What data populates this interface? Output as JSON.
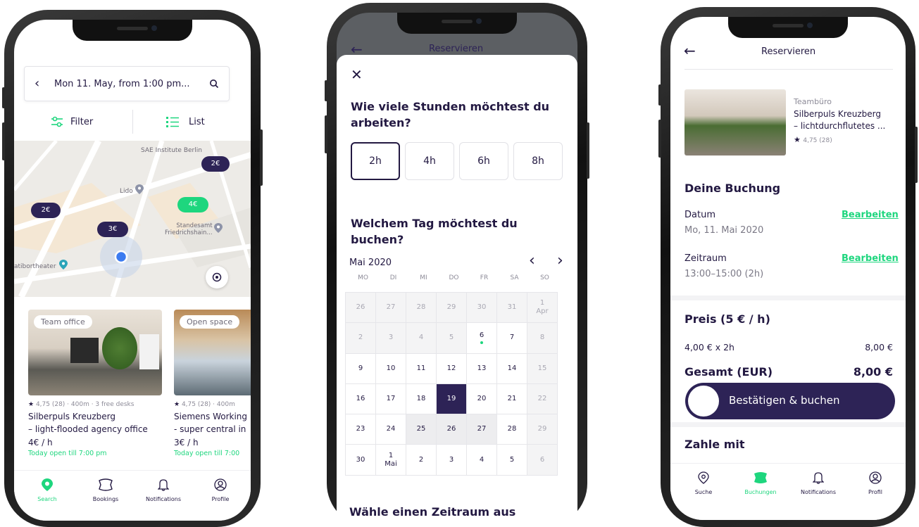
{
  "phone1": {
    "search": {
      "text": "Mon 11. May, from 1:00 pm..."
    },
    "filter_label": "Filter",
    "list_label": "List",
    "map": {
      "labels": {
        "sae": "SAE Institute Berlin",
        "lido": "Lido",
        "standesamt": "Standesamt\nFriedrichshain...",
        "theater": "atibortheater"
      },
      "pins": [
        {
          "label": "2€",
          "color": "#2d2356"
        },
        {
          "label": "4€",
          "color": "#1ed67e"
        },
        {
          "label": "2€",
          "color": "#2d2356"
        },
        {
          "label": "3€",
          "color": "#2d2356"
        }
      ]
    },
    "cards": [
      {
        "badge": "Team office",
        "meta": "4,75 (28) · 400m · 3 free desks",
        "title1": "Silberpuls Kreuzberg",
        "title2": "– light-flooded agency office",
        "price": "4€ / h",
        "open": "Today open till 7:00 pm"
      },
      {
        "badge": "Open space",
        "meta": "4,75 (28) · 400m",
        "title1": "Siemens Working",
        "title2": "- super central in",
        "price": "3€ / h",
        "open": "Today open till 7:00"
      }
    ],
    "tabs": [
      "Search",
      "Bookings",
      "Notifications",
      "Profile"
    ]
  },
  "phone2": {
    "header_title": "Reservieren",
    "question_hours": "Wie viele Stunden möchtest du arbeiten?",
    "hours": [
      "2h",
      "4h",
      "6h",
      "8h"
    ],
    "selected_hours": "2h",
    "question_day": "Welchem Tag möchtest du buchen?",
    "month": "Mai 2020",
    "weekdays": [
      "MO",
      "DI",
      "MI",
      "DO",
      "FR",
      "SA",
      "SO"
    ],
    "calendar": [
      [
        [
          "26",
          "",
          "past"
        ],
        [
          "27",
          "",
          "past"
        ],
        [
          "28",
          "",
          "past"
        ],
        [
          "29",
          "",
          "past"
        ],
        [
          "30",
          "",
          "past"
        ],
        [
          "31",
          "",
          "past"
        ],
        [
          "1",
          "Apr",
          "past"
        ]
      ],
      [
        [
          "2",
          "",
          "past"
        ],
        [
          "3",
          "",
          "past"
        ],
        [
          "4",
          "",
          "past"
        ],
        [
          "5",
          "",
          "past"
        ],
        [
          "6",
          "",
          "dot"
        ],
        [
          "7",
          "",
          ""
        ],
        [
          "8",
          "",
          "past"
        ]
      ],
      [
        [
          "9",
          "",
          ""
        ],
        [
          "10",
          "",
          ""
        ],
        [
          "11",
          "",
          ""
        ],
        [
          "12",
          "",
          ""
        ],
        [
          "13",
          "",
          ""
        ],
        [
          "14",
          "",
          ""
        ],
        [
          "15",
          "",
          "past"
        ]
      ],
      [
        [
          "16",
          "",
          ""
        ],
        [
          "17",
          "",
          ""
        ],
        [
          "18",
          "",
          ""
        ],
        [
          "19",
          "",
          "sel"
        ],
        [
          "20",
          "",
          ""
        ],
        [
          "21",
          "",
          ""
        ],
        [
          "22",
          "",
          "past"
        ]
      ],
      [
        [
          "23",
          "",
          ""
        ],
        [
          "24",
          "",
          ""
        ],
        [
          "25",
          "",
          "blocked"
        ],
        [
          "26",
          "",
          "blocked"
        ],
        [
          "27",
          "",
          "blocked"
        ],
        [
          "28",
          "",
          ""
        ],
        [
          "29",
          "",
          "past"
        ]
      ],
      [
        [
          "30",
          "",
          ""
        ],
        [
          "1",
          "Mai",
          ""
        ],
        [
          "2",
          "",
          ""
        ],
        [
          "3",
          "",
          ""
        ],
        [
          "4",
          "",
          ""
        ],
        [
          "5",
          "",
          ""
        ],
        [
          "6",
          "",
          "past"
        ]
      ]
    ],
    "bottom_heading": "Wähle einen Zeitraum aus"
  },
  "phone3": {
    "header_title": "Reservieren",
    "listing": {
      "type": "Teambüro",
      "title1": "Silberpuls Kreuzberg",
      "title2": "– lichtdurchflutetes ...",
      "rating": "4,75 (28)"
    },
    "booking_heading": "Deine Buchung",
    "date_label": "Datum",
    "date_value": "Mo, 11. Mai 2020",
    "time_label": "Zeitraum",
    "time_value": "13:00–15:00 (2h)",
    "edit_label": "Bearbeiten",
    "price_heading": "Preis (5 € / h)",
    "line_label": "4,00 € x 2h",
    "line_value": "8,00 €",
    "total_label": "Gesamt (EUR)",
    "total_value": "8,00 €",
    "confirm_label": "Bestätigen & buchen",
    "pay_heading": "Zahle mit",
    "tabs": [
      "Suche",
      "Buchungen",
      "Notifications",
      "Profil"
    ]
  },
  "colors": {
    "navy": "#2d2356",
    "green": "#1ed67e",
    "text": "#231942"
  }
}
